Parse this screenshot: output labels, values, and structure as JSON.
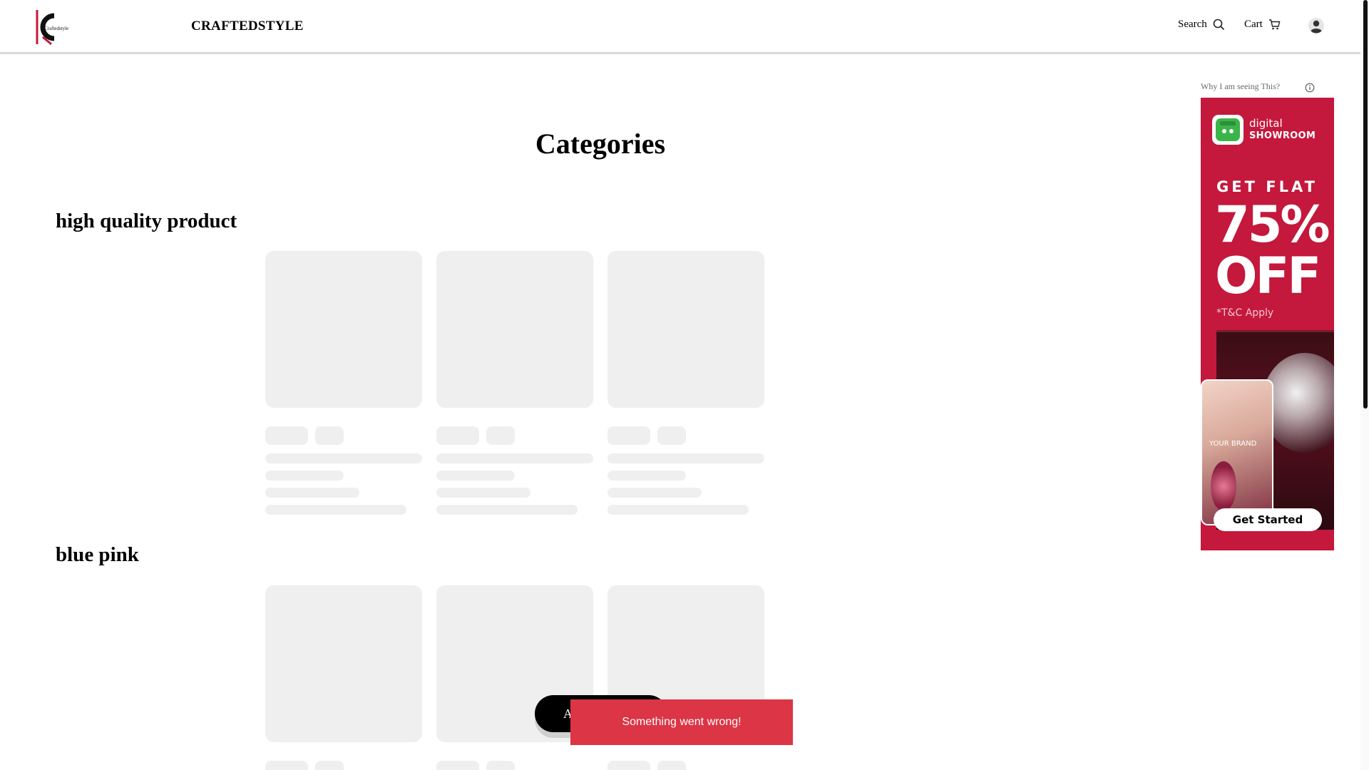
{
  "header": {
    "logo_text": "Craftedstyle",
    "brand_name": "CRAFTEDSTYLE",
    "search_label": "Search",
    "cart_label": "Cart"
  },
  "main": {
    "page_title": "Categories",
    "sections": [
      {
        "title": "high quality product"
      },
      {
        "title": "blue pink"
      }
    ]
  },
  "ad": {
    "why_label": "Why I am seeing This?",
    "brand_line1": "digital",
    "brand_line2": "SHOWROOM",
    "headline1": "GET FLAT",
    "headline2": "75%",
    "headline3": "OFF",
    "terms": "*T&C Apply",
    "mock_text": "YOUR BRAND",
    "cta_label": "Get Started"
  },
  "fab": {
    "label": "A"
  },
  "toast": {
    "message": "Something went wrong!"
  },
  "colors": {
    "accent_red": "#dc3545",
    "ad_background": "#c4183c",
    "skeleton": "#efefef"
  },
  "icons": {
    "search": "search-icon",
    "cart": "cart-icon",
    "user": "user-icon",
    "info": "info-icon"
  }
}
